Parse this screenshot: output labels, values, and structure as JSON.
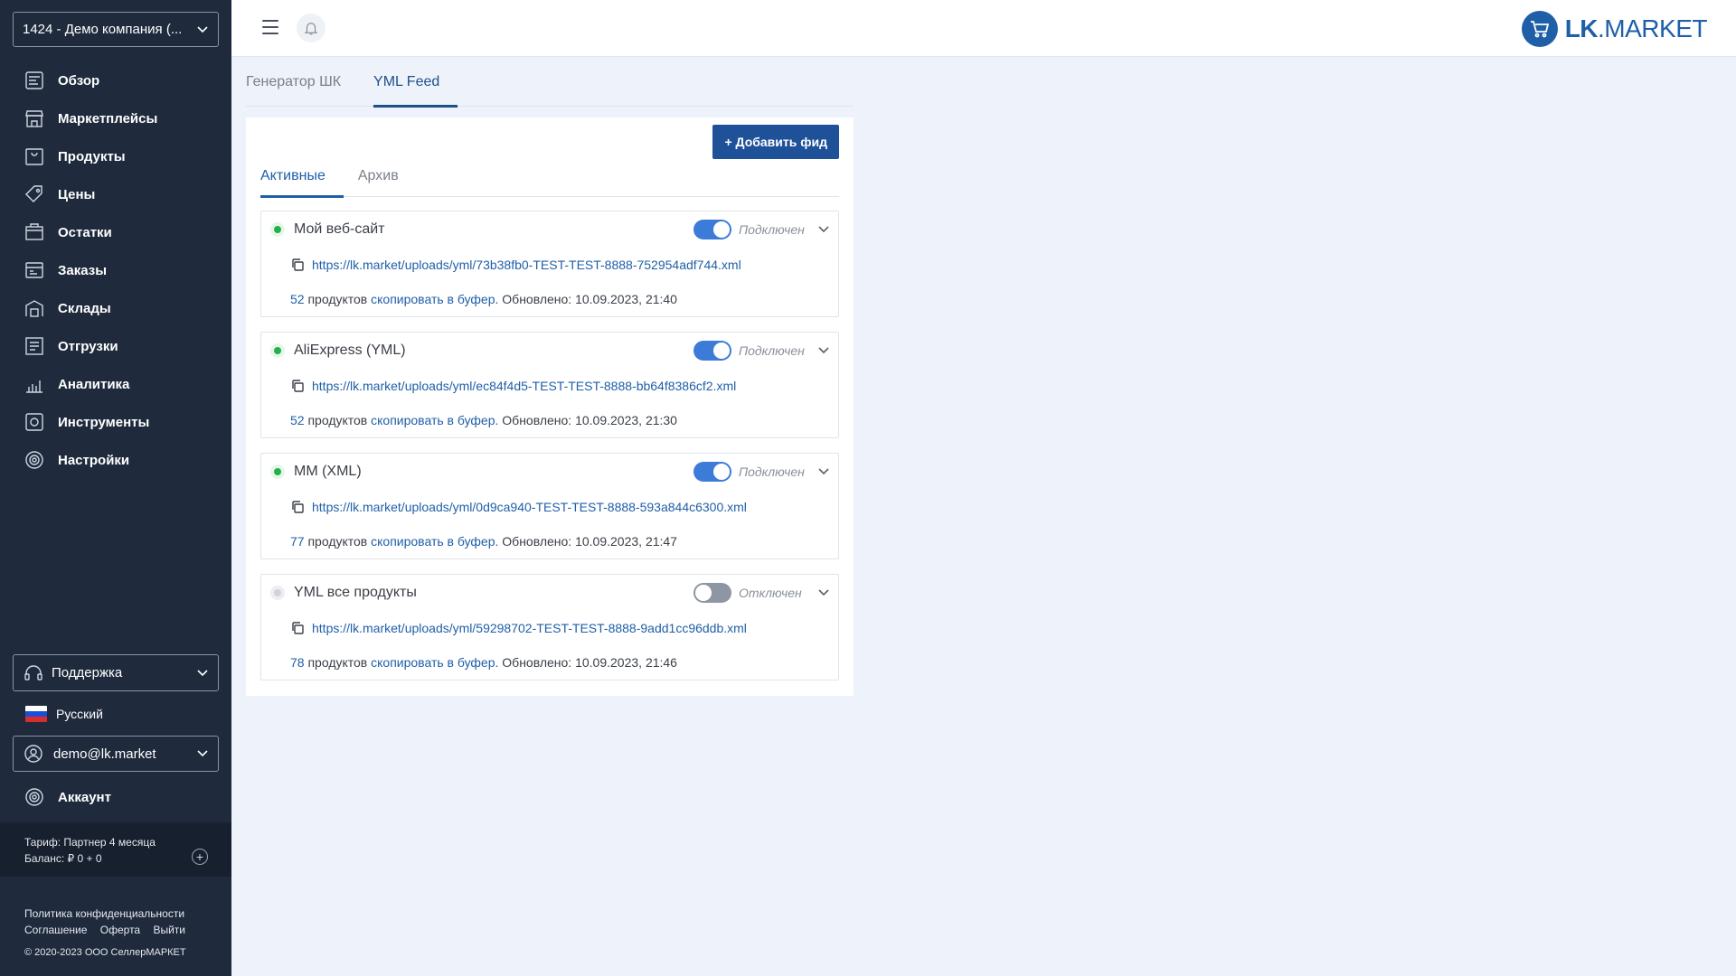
{
  "sidebar": {
    "company": "1424 - Демо компания (...",
    "nav": [
      {
        "label": "Обзор",
        "icon": "overview-icon"
      },
      {
        "label": "Маркетплейсы",
        "icon": "marketplaces-icon"
      },
      {
        "label": "Продукты",
        "icon": "products-icon"
      },
      {
        "label": "Цены",
        "icon": "prices-icon"
      },
      {
        "label": "Остатки",
        "icon": "stock-icon"
      },
      {
        "label": "Заказы",
        "icon": "orders-icon"
      },
      {
        "label": "Склады",
        "icon": "warehouses-icon"
      },
      {
        "label": "Отгрузки",
        "icon": "shipments-icon"
      },
      {
        "label": "Аналитика",
        "icon": "analytics-icon"
      },
      {
        "label": "Инструменты",
        "icon": "tools-icon"
      },
      {
        "label": "Настройки",
        "icon": "settings-icon"
      }
    ],
    "support": "Поддержка",
    "language": "Русский",
    "user_email": "demo@lk.market",
    "account": "Аккаунт",
    "tariff": "Тариф: Партнер 4 месяца",
    "balance": "Баланс: ₽ 0 + 0",
    "plus": "+",
    "privacy": "Политика конфиденциальности",
    "agreement": "Соглашение",
    "offer": "Оферта",
    "logout": "Выйти",
    "copyright": "© 2020-2023 ООО СеллерМАРКЕТ"
  },
  "topbar": {
    "logo_bold": "LK",
    "logo_rest": ".MARKET"
  },
  "main_tabs": [
    "Генератор ШК",
    "YML Feed"
  ],
  "panel": {
    "add_button": "+ Добавить фид",
    "sub_tabs": [
      "Активные",
      "Архив"
    ]
  },
  "feeds": [
    {
      "name": "Мой веб-сайт",
      "enabled": true,
      "status": "Подключен",
      "url": "https://lk.market/uploads/yml/73b38fb0-TEST-TEST-8888-752954adf744.xml",
      "count": "52",
      "products_word": " продуктов ",
      "copy": "скопировать в буфер.",
      "updated": " Обновлено: 10.09.2023, 21:40"
    },
    {
      "name": "AliExpress (YML)",
      "enabled": true,
      "status": "Подключен",
      "url": "https://lk.market/uploads/yml/ec84f4d5-TEST-TEST-8888-bb64f8386cf2.xml",
      "count": "52",
      "products_word": " продуктов ",
      "copy": "скопировать в буфер.",
      "updated": " Обновлено: 10.09.2023, 21:30"
    },
    {
      "name": "MM (XML)",
      "enabled": true,
      "status": "Подключен",
      "url": "https://lk.market/uploads/yml/0d9ca940-TEST-TEST-8888-593a844c6300.xml",
      "count": "77",
      "products_word": " продуктов ",
      "copy": "скопировать в буфер.",
      "updated": " Обновлено: 10.09.2023, 21:47"
    },
    {
      "name": "YML все продукты",
      "enabled": false,
      "status": "Отключен",
      "url": "https://lk.market/uploads/yml/59298702-TEST-TEST-8888-9add1cc96ddb.xml",
      "count": "78",
      "products_word": " продуктов ",
      "copy": "скопировать в буфер.",
      "updated": " Обновлено: 10.09.2023, 21:46"
    }
  ]
}
